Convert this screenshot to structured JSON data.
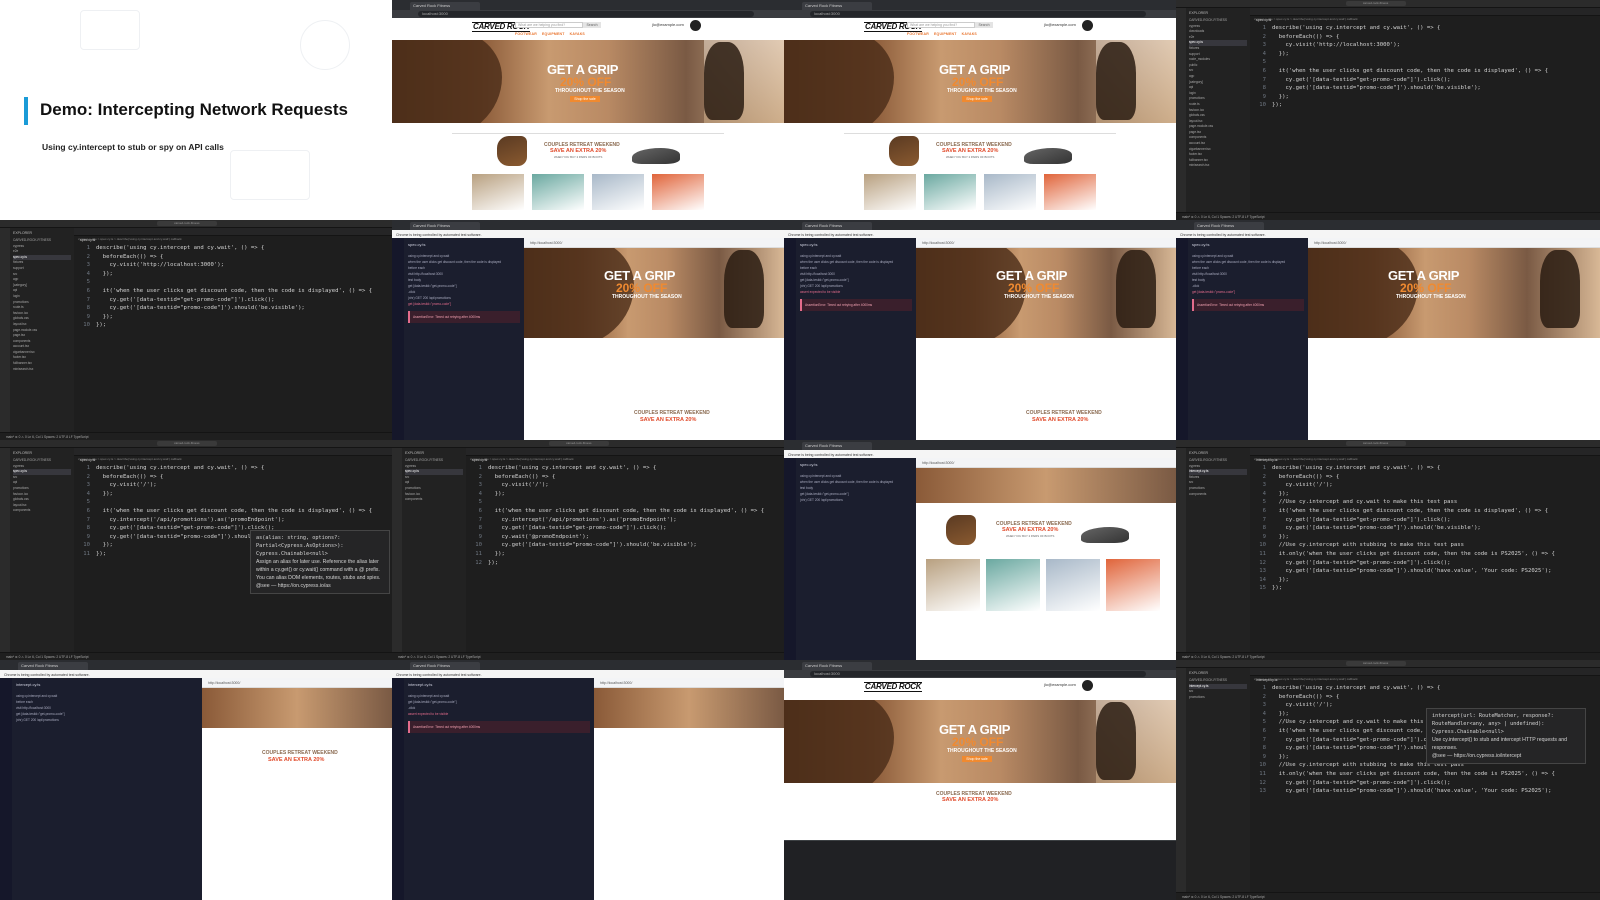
{
  "slide": {
    "title": "Demo: Intercepting Network Requests",
    "subtitle": "Using cy.intercept to stub or spy on API calls"
  },
  "browser": {
    "tab_label": "Carved Rock Fitness",
    "url": "localhost:3000",
    "logo": "CARVED ROCK",
    "search_placeholder": "What are we helping you find?",
    "search_button": "Search",
    "user_email": "jlo@example.com",
    "nav": [
      "FOOTWEAR",
      "EQUIPMENT",
      "KAYAKS"
    ],
    "hero_line1": "GET A GRIP",
    "hero_line2": "20% OFF",
    "hero_line3": "THROUGHOUT THE SEASON",
    "hero_button": "Shop the sale",
    "promo_line1": "COUPLES RETREAT WEEKEND",
    "promo_line2": "SAVE AN EXTRA 20%",
    "promo_line3": "WHEN YOU BUY 2 PAIRS OF BOOTS",
    "thumb_colors": [
      "#b8a080",
      "#6aa8a0",
      "#a8b8c8",
      "#e0643a"
    ]
  },
  "vscode": {
    "explorer_header": "EXPLORER",
    "project": "CARVED-ROCK-FITNESS",
    "tree": [
      "cypress",
      "downloads",
      "e2e",
      "spec.cy.ts",
      "fixtures",
      "support",
      "node_modules",
      "public",
      "src",
      "app",
      "[category]",
      "api",
      "login",
      "promotions",
      "route.ts",
      "favicon.ico",
      "globals.css",
      "layout.tsx",
      "page.module.css",
      "page.tsx",
      "components",
      "account.tsx",
      "cigarbanner.tsx",
      "footer.tsx",
      "fullbanner.tsx",
      "minisearch.tsx"
    ],
    "file_tab": "spec.cy.ts",
    "intercept_tab": "intercept.cy.ts",
    "breadcrumb": "cypress > e2e > spec.cy.ts > describe('using cy.intercept and cy.wait') callback",
    "status": "main*  ⊗ 0 ⚠ 0   Ln 6, Col 1  Spaces: 2  UTF-8  LF  TypeScript",
    "command_center": "carved-rock-fitness",
    "tooltip1_sig": "as(alias: string, options?: Partial<Cypress.AsOptions>): Cypress.Chainable<null>",
    "tooltip1_desc": "Assign an alias for later use. Reference the alias later within a cy.get() or cy.wait() command with a @ prefix. You can alias DOM elements, routes, stubs and spies.",
    "tooltip1_see": "@see — https://on.cypress.io/as",
    "tooltip2_sig": "intercept(url: RouteMatcher, response?: RouteHandler<any, any> | undefined): Cypress.Chainable<null>",
    "tooltip2_desc": "Use cy.intercept() to stub and intercept HTTP requests and responses.",
    "tooltip2_see": "@see — https://on.cypress.io/intercept"
  },
  "code": {
    "a1": "describe('using cy.intercept and cy.wait', () => {",
    "a2": "  beforeEach(() => {",
    "a3": "    cy.visit('http://localhost:3000');",
    "a4": "  });",
    "a5": "  it('when the user clicks get discount code, then the code is displayed', () => {",
    "a6": "    cy.get('[data-testid=\"get-promo-code\"]').click();",
    "a7": "    cy.get('[data-testid=\"promo-code\"]').should('be.visible');",
    "a8": "  });",
    "a9": "});",
    "b3": "    cy.visit('/');",
    "b6": "    cy.intercept('/api/promotions').as('promoEndpoint');",
    "b7": "    cy.wait('@promoEndpoint');",
    "c5": "  //Use cy.intercept and cy.wait to make this test pass",
    "c9": "  //Use cy.intercept with stubbing to make this test pass",
    "c10": "  it.only('when the user clicks get discount code, then the code is PS2025', () => {",
    "c12": "    cy.get('[data-testid=\"promo-code\"]').should('have.value', 'Your code: PS2025');"
  },
  "runner": {
    "notice": "Chrome is being controlled by automated test software.",
    "spec": "spec.cy.ts",
    "url": "http://localhost:3000/",
    "suite": "using cy.intercept and cy.wait",
    "test": "when the user clicks get discount code, then the code is displayed",
    "rows": [
      "before each",
      "visit  http://localhost:3000",
      "test body",
      "get  [data-testid=\"get-promo-code\"]",
      "-click",
      "(xhr)  GET 200 /api/promotions",
      "get  [data-testid=\"promo-code\"]",
      "assert  expected to be visible"
    ],
    "error": "AssertionError: Timed out retrying after 4000ms",
    "viewport": "1000x660 (75%)"
  }
}
